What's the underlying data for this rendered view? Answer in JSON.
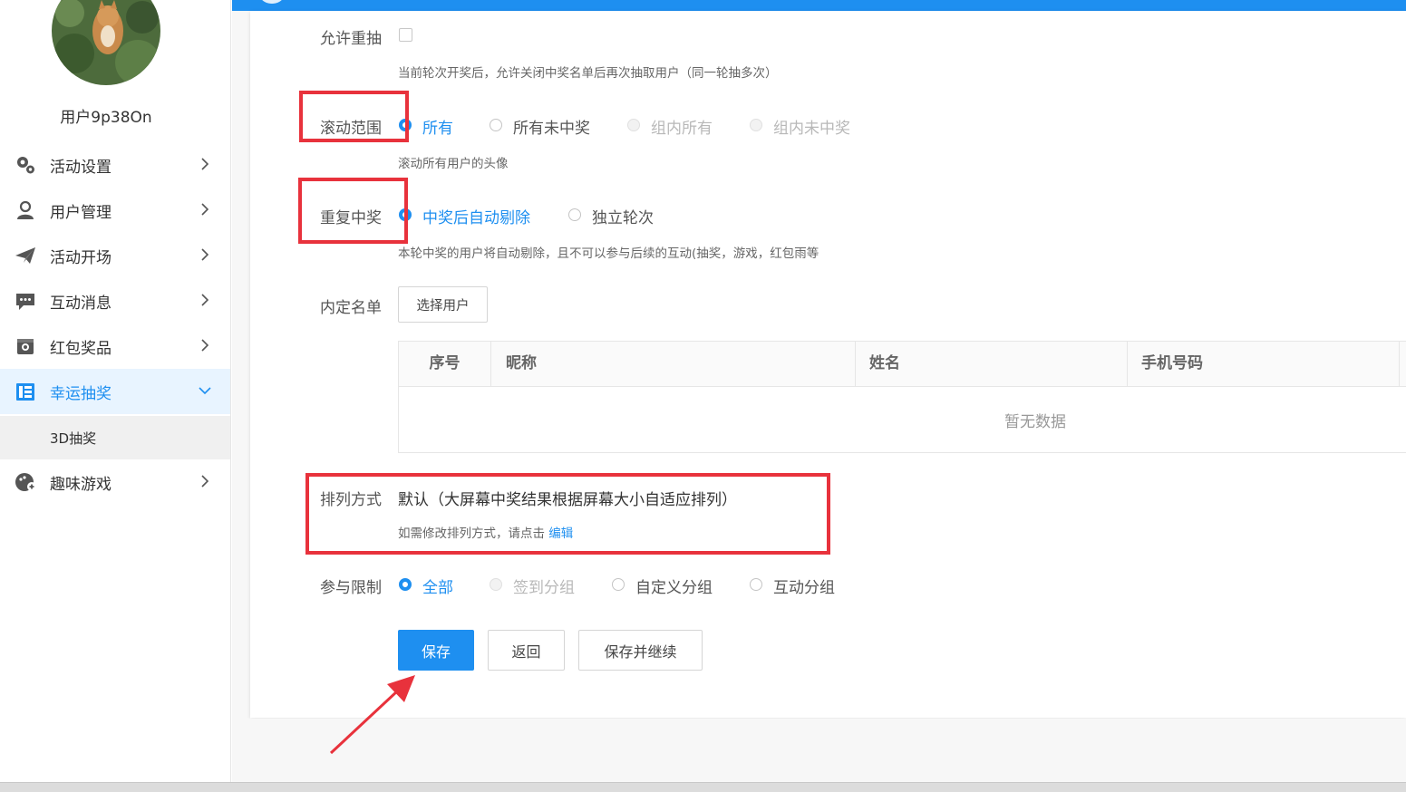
{
  "sidebar": {
    "username": "用户9p38On",
    "items": [
      {
        "label": "活动设置",
        "icon": "gears-icon"
      },
      {
        "label": "用户管理",
        "icon": "user-icon"
      },
      {
        "label": "活动开场",
        "icon": "paper-plane-icon"
      },
      {
        "label": "互动消息",
        "icon": "chat-bubble-icon"
      },
      {
        "label": "红包奖品",
        "icon": "gift-icon"
      },
      {
        "label": "幸运抽奖",
        "icon": "lottery-icon",
        "expanded": true
      },
      {
        "label": "趣味游戏",
        "icon": "game-icon"
      }
    ],
    "sub_item": "3D抽奖"
  },
  "form": {
    "allow_redraw": {
      "label": "允许重抽",
      "checked": false,
      "hint": "当前轮次开奖后，允许关闭中奖名单后再次抽取用户（同一轮抽多次）"
    },
    "scroll_range": {
      "label": "滚动范围",
      "options": [
        "所有",
        "所有未中奖",
        "组内所有",
        "组内未中奖"
      ],
      "selected": "所有",
      "hint": "滚动所有用户的头像"
    },
    "repeat_win": {
      "label": "重复中奖",
      "options": [
        "中奖后自动剔除",
        "独立轮次"
      ],
      "selected": "中奖后自动剔除",
      "hint": "本轮中奖的用户将自动剔除，且不可以参与后续的互动(抽奖，游戏，红包雨等"
    },
    "whitelist": {
      "label": "内定名单",
      "button": "选择用户",
      "columns": [
        "序号",
        "昵称",
        "姓名",
        "手机号码"
      ],
      "rows": [],
      "empty_text": "暂无数据"
    },
    "arrangement": {
      "label": "排列方式",
      "value": "默认（大屏幕中奖结果根据屏幕大小自适应排列）",
      "hint_prefix": "如需修改排列方式，请点击",
      "hint_link": "编辑"
    },
    "participation": {
      "label": "参与限制",
      "options": [
        "全部",
        "签到分组",
        "自定义分组",
        "互动分组"
      ],
      "selected": "全部"
    },
    "buttons": {
      "save": "保存",
      "back": "返回",
      "save_continue": "保存并继续"
    }
  },
  "colors": {
    "primary": "#1e8ff0",
    "annotation": "#e8323c"
  }
}
